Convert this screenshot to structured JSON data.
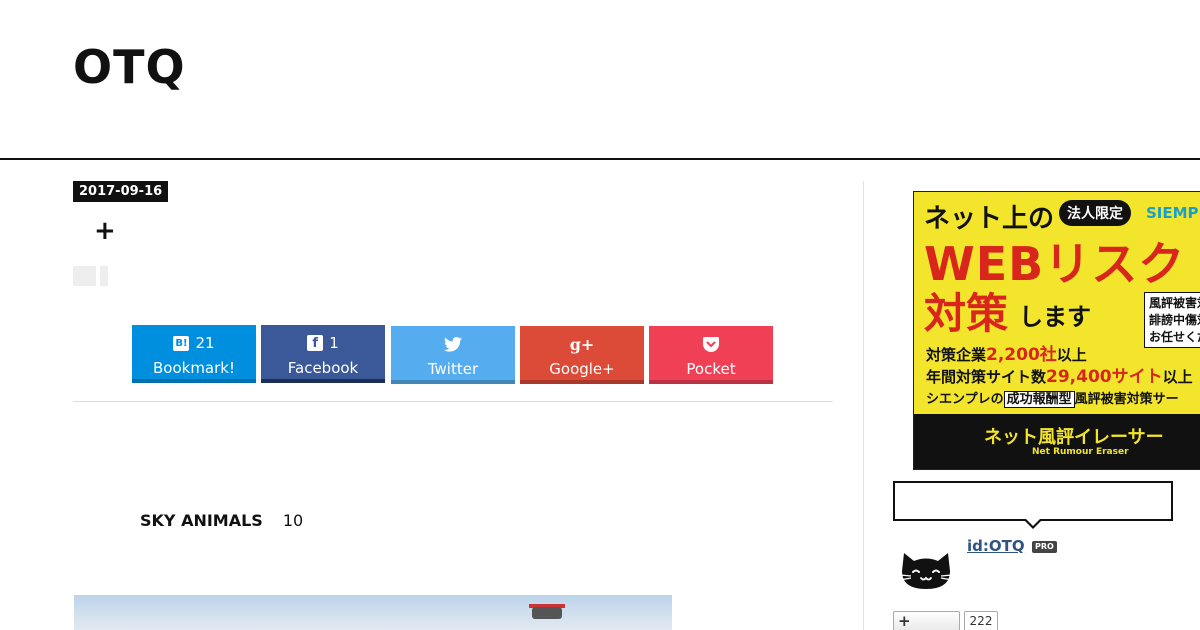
{
  "site": {
    "title": "OTQ"
  },
  "entry": {
    "date": "2017-09-16",
    "plus_glyph": "+",
    "sky_title": "SKY ANIMALS",
    "sky_count": "10"
  },
  "share": {
    "hatena": {
      "icon": "hatena-bookmark-icon",
      "icon_text": "B!",
      "count": "21",
      "label": "Bookmark!",
      "color": "#008fde"
    },
    "facebook": {
      "icon": "facebook-icon",
      "icon_text": "f",
      "count": "1",
      "label": "Facebook",
      "color": "#3b5998"
    },
    "twitter": {
      "icon": "twitter-bird-icon",
      "label": "Twitter",
      "color": "#55acee"
    },
    "google": {
      "icon": "google-plus-icon",
      "icon_text": "g+",
      "label": "Google+",
      "color": "#dc4a38"
    },
    "pocket": {
      "icon": "pocket-icon",
      "label": "Pocket",
      "color": "#ef4056"
    }
  },
  "ad": {
    "line1": "ネット上の",
    "badge": "法人限定",
    "brand": "SIEMP",
    "line2": "WEBリスク",
    "line3": "対策",
    "line3b": "します",
    "side_box": [
      "風評被害対",
      "誹謗中傷対",
      "お任せくだ"
    ],
    "line4_prefix": "対策企業",
    "line4_red": "2,200社",
    "line4_suffix": "以上",
    "line5_prefix": "年間対策サイト数",
    "line5_red": "29,400サイト",
    "line5_suffix": "以上",
    "line6_prefix": "シエンプレの",
    "line6_boxed": "成功報酬型",
    "line6_suffix": "風評被害対策サー",
    "footer_main": "ネット風評イレーサー",
    "footer_sub": "Net Rumour Eraser",
    "colors": {
      "background": "#f3e52b",
      "accent": "#d9261c"
    }
  },
  "profile": {
    "id": "id:OTQ",
    "pro_badge": "PRO",
    "avatar_icon": "cat-avatar-icon"
  },
  "follow": {
    "plus": "+",
    "count": "222"
  }
}
